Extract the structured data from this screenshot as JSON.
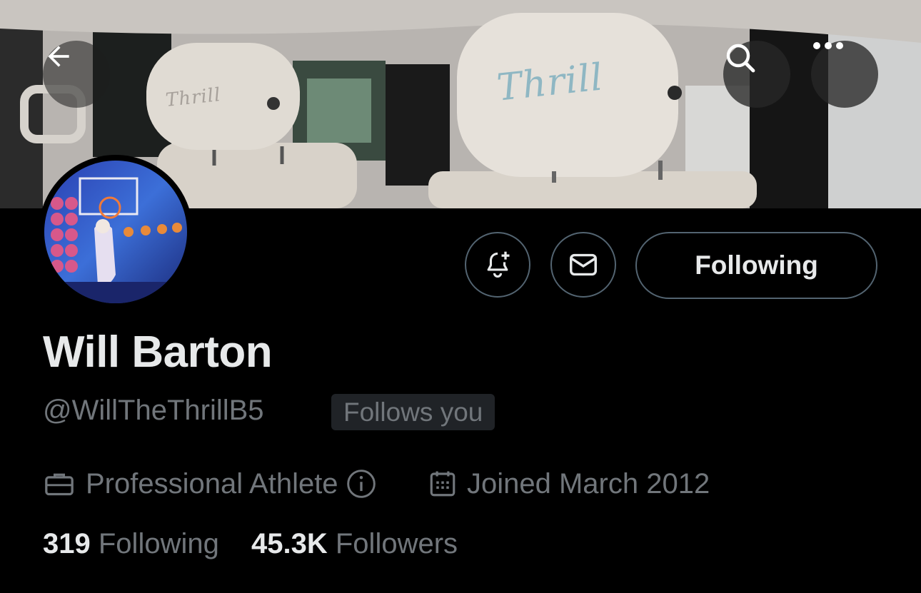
{
  "header": {
    "back_icon": "arrow-left-icon",
    "search_icon": "search-icon",
    "more_icon": "more-horizontal-icon",
    "banner_headrest_text": "Thrill",
    "banner_headrest_text_small": "Thrill"
  },
  "actions": {
    "notify_icon": "bell-plus-icon",
    "message_icon": "envelope-icon",
    "following_label": "Following"
  },
  "profile": {
    "display_name": "Will Barton",
    "handle": "@WillTheThrillB5",
    "follows_you_badge": "Follows you",
    "profession": "Professional Athlete",
    "joined": "Joined March 2012"
  },
  "stats": {
    "following_count": "319",
    "following_label": "Following",
    "followers_count": "45.3K",
    "followers_label": "Followers"
  },
  "colors": {
    "background": "#000000",
    "primary_text": "#e7e9ea",
    "secondary_text": "#71767b",
    "border": "#536471",
    "badge_bg": "#202327"
  }
}
